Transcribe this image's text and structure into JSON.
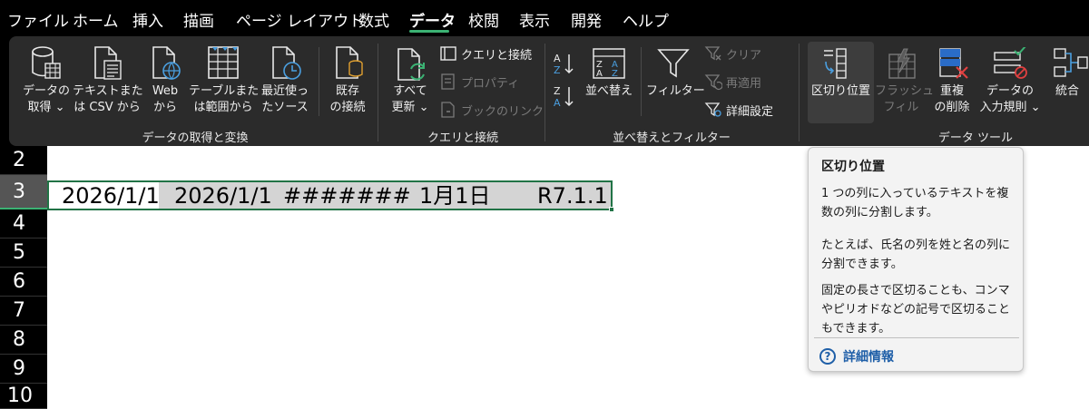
{
  "menu": {
    "tabs": [
      "ファイル",
      "ホーム",
      "挿入",
      "描画",
      "ページ レイアウト",
      "数式",
      "データ",
      "校閲",
      "表示",
      "開発",
      "ヘルプ"
    ],
    "active_tab": "データ"
  },
  "ribbon": {
    "groups": {
      "get_transform": {
        "label": "データの取得と変換",
        "buttons": {
          "get_data": [
            "データの",
            "取得 ⌄"
          ],
          "from_text_csv": [
            "テキストまた",
            "は CSV から"
          ],
          "from_web": [
            "Web",
            "から"
          ],
          "from_table": [
            "テーブルまた",
            "は範囲から"
          ],
          "recent_sources": [
            "最近使っ",
            "たソース"
          ],
          "existing_connections": [
            "既存",
            "の接続"
          ]
        }
      },
      "queries": {
        "label": "クエリと接続",
        "refresh_all": [
          "すべて",
          "更新 ⌄"
        ],
        "queries_connections": "クエリと接続",
        "properties": "プロパティ",
        "workbook_links": "ブックのリンク"
      },
      "sort_filter": {
        "label": "並べ替えとフィルター",
        "sort": "並べ替え",
        "filter": "フィルター",
        "clear": "クリア",
        "reapply": "再適用",
        "advanced": "詳細設定"
      },
      "data_tools": {
        "label": "データ ツール",
        "text_to_columns": "区切り位置",
        "flash_fill": [
          "フラッシュ",
          "フィル"
        ],
        "remove_duplicates": [
          "重複",
          "の削除"
        ],
        "data_validation": [
          "データの",
          "入力規則 ⌄"
        ],
        "consolidate": "統合"
      }
    }
  },
  "sheet": {
    "rows": [
      "2",
      "3",
      "4",
      "5",
      "6",
      "7",
      "8",
      "9",
      "10"
    ],
    "selected_row": "3",
    "cells": [
      "2026/1/1",
      "2026/1/1",
      "#######",
      "1月1日",
      "R7.1.1"
    ]
  },
  "tooltip": {
    "title": "区切り位置",
    "para1": "1 つの列に入っているテキストを複数の列に分割します。",
    "para2": "たとえば、氏名の列を姓と名の列に分割できます。",
    "para3": "固定の長さで区切ることも、コンマやピリオドなどの記号で区切ることもできます。",
    "more_info": "詳細情報"
  },
  "colors": {
    "accent_green": "#217346",
    "tab_underline": "#3bb273",
    "link_blue": "#1f5fa8"
  }
}
